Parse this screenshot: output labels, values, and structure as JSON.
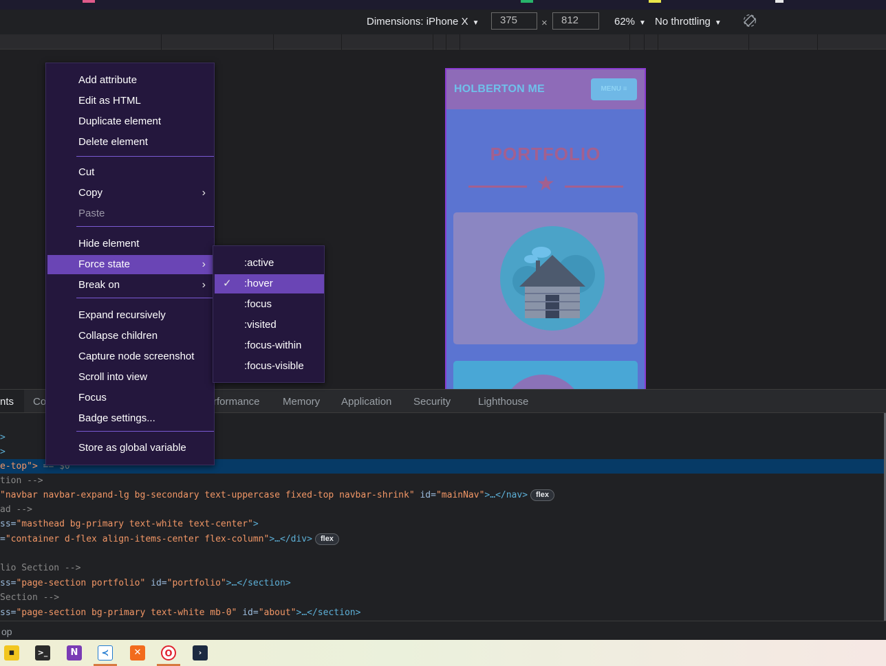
{
  "device_toolbar": {
    "dimensions_label": "Dimensions: iPhone X",
    "width_value": "375",
    "times_symbol": "×",
    "height_value": "812",
    "zoom": "62%",
    "throttling": "No throttling"
  },
  "mobile_page": {
    "brand": "HOLBERTON ME",
    "menu_button": "MENU ≡",
    "heading": "PORTFOLIO"
  },
  "context_menu": {
    "items": [
      {
        "label": "Add attribute"
      },
      {
        "label": "Edit as HTML"
      },
      {
        "label": "Duplicate element"
      },
      {
        "label": "Delete element"
      },
      {
        "label": "Cut"
      },
      {
        "label": "Copy",
        "submenu": true
      },
      {
        "label": "Paste",
        "disabled": true
      },
      {
        "label": "Hide element"
      },
      {
        "label": "Force state",
        "submenu": true,
        "highlighted": true
      },
      {
        "label": "Break on",
        "submenu": true
      },
      {
        "label": "Expand recursively"
      },
      {
        "label": "Collapse children"
      },
      {
        "label": "Capture node screenshot"
      },
      {
        "label": "Scroll into view"
      },
      {
        "label": "Focus"
      },
      {
        "label": "Badge settings..."
      },
      {
        "label": "Store as global variable"
      }
    ]
  },
  "force_state_submenu": {
    "items": [
      {
        "label": ":active",
        "checked": false
      },
      {
        "label": ":hover",
        "checked": true
      },
      {
        "label": ":focus",
        "checked": false
      },
      {
        "label": ":visited",
        "checked": false
      },
      {
        "label": ":focus-within",
        "checked": false
      },
      {
        "label": ":focus-visible",
        "checked": false
      }
    ]
  },
  "devtools_tabs": [
    "nts",
    "Co",
    "rformance",
    "Memory",
    "Application",
    "Security",
    "Lighthouse"
  ],
  "dom_lines": {
    "l1": ">",
    "l2": ">",
    "l3_tag": "e-top\">",
    "l3_rest": " == $0",
    "l4": "tion -->",
    "l5_val": "\"navbar navbar-expand-lg bg-secondary text-uppercase fixed-top navbar-shrink\"",
    "l5_attr": " id=",
    "l5_val2": "\"mainNav\"",
    "l5_tag": ">…</nav>",
    "l5_badge": "flex",
    "l6": "ad -->",
    "l7_attr": "ss=",
    "l7_val": "\"masthead bg-primary text-white text-center\"",
    "l7_tag": ">",
    "l8_attr": "=",
    "l8_val": "\"container d-flex align-items-center flex-column\"",
    "l8_tag": ">…</div>",
    "l8_badge": "flex",
    "l9": "lio Section -->",
    "l10_attr": "ss=",
    "l10_val": "\"page-section portfolio\"",
    "l10_attr2": " id=",
    "l10_val2": "\"portfolio\"",
    "l10_tag": ">…</section>",
    "l11": "Section -->",
    "l12_attr": "ss=",
    "l12_val": "\"page-section bg-primary text-white mb-0\"",
    "l12_attr2": " id=",
    "l12_val2": "\"about\"",
    "l12_tag": ">…</section>"
  },
  "breadcrumb": "op",
  "colors": {
    "menu_bg": "#24173d",
    "menu_highlight": "#6a45b5",
    "separator": "#7a5ad3",
    "selected_row": "#063a66"
  }
}
